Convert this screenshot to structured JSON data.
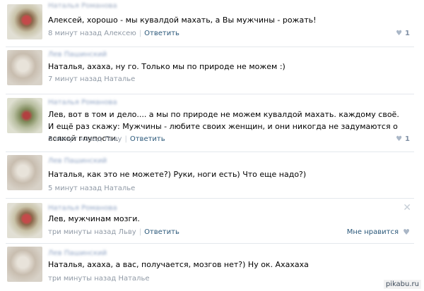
{
  "comments": [
    {
      "author": "Наталья Романова",
      "text": "Алексей, хорошо - мы кувалдой махать, а Вы мужчины - рожать!",
      "time": "8 минут назад Алексею",
      "reply": "Ответить",
      "likes": "1"
    },
    {
      "author": "Лев Пашинский",
      "text": "Наталья, ахаха, ну го. Только мы по природе не можем :)",
      "time": "7 минут назад Наталье"
    },
    {
      "author": "Наталья Романова",
      "text": "Лев, вот в том и дело.... а мы по природе не можем кувалдой махать. каждому своё. И ещё раз скажу: Мужчины - любите своих женщин, и они никогда не задумаются о всякой глупости.",
      "time": "5 минут назад Льву",
      "reply": "Ответить",
      "likes": "1"
    },
    {
      "author": "Лев Пашинский",
      "text": "Наталья, как это не можете?) Руки, ноги есть) Что еще надо?)",
      "time": "5 минут назад Наталье"
    },
    {
      "author": "Наталья Романова",
      "text": "Лев, мужчинам мозги.",
      "time": "три минуты назад Льву",
      "reply": "Ответить",
      "like_label": "Мне нравится",
      "close": "✕"
    },
    {
      "author": "Лев Пашинский",
      "text": "Наталья, ахаха, а вас, получается, мозгов нет?) Ну ок. Ахахаха",
      "time": "три минуты назад Наталье"
    }
  ],
  "watermark": "pikabu.ru",
  "icons": {
    "heart": "heart-icon",
    "close": "close-icon"
  }
}
